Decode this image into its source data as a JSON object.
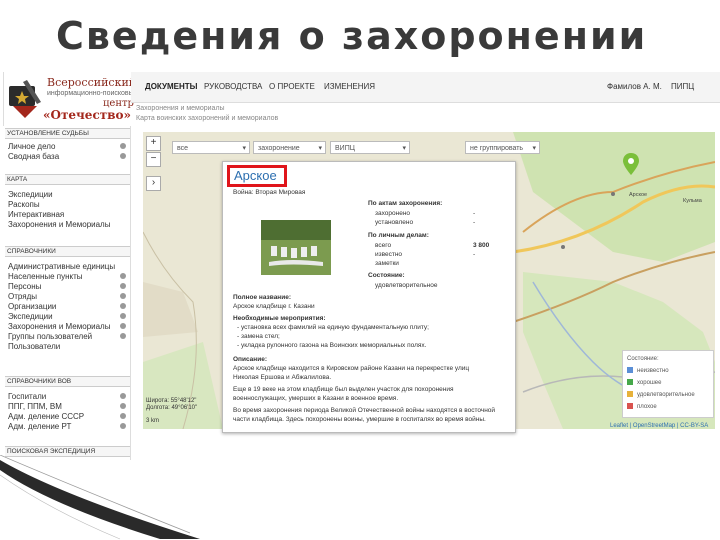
{
  "slide_title": "Сведения о захоронении",
  "logo": {
    "line1": "Всероссийский",
    "line2": "информационно-поисковый",
    "line3": "центр",
    "line4": "«Отечество»"
  },
  "topnav": {
    "items": [
      "ДОКУМЕНТЫ",
      "РУКОВОДСТВА",
      "О ПРОЕКТЕ",
      "ИЗМЕНЕНИЯ"
    ],
    "user": "Фамилов А. М.",
    "org": "ПИПЦ"
  },
  "breadcrumb": {
    "line1": "Захоронения и мемориалы",
    "line2": "Карта воинских захоронений и мемориалов"
  },
  "sidebar": {
    "section1": "УСТАНОВЛЕНИЕ СУДЬБЫ",
    "section1_items": [
      "Личное дело",
      "Сводная база"
    ],
    "section2": "КАРТА",
    "section2_items": [
      "Экспедиции",
      "Раскопы",
      "Интерактивная",
      "Захоронения и Мемориалы"
    ],
    "section3": "СПРАВОЧНИКИ",
    "section3_items": [
      "Административные единицы",
      "Населенные пункты",
      "Персоны",
      "Отряды",
      "Организации",
      "Экспедиции",
      "Захоронения и Мемориалы",
      "Группы пользователей",
      "Пользователи"
    ],
    "section4": "СПРАВОЧНИКИ ВОВ",
    "section4_items": [
      "Госпитали",
      "ППГ, ППМ, ВМ",
      "Адм. деление СССР",
      "Адм. деление РТ"
    ],
    "section5": "ПОИСКОВАЯ ЭКСПЕДИЦИЯ"
  },
  "map": {
    "zoom_in": "+",
    "zoom_out": "−",
    "toggle": "›",
    "filters": [
      "все",
      "захоронение",
      "ВИПЦ",
      "не группировать"
    ],
    "scale_label": "3 km",
    "coord_line1": "Широта: 55°48'12\"",
    "coord_line2": "Долгота: 49°06'10\"",
    "attribution": "Leaflet | OpenStreetMap | CC-BY-SA",
    "place_label1": "Арское",
    "place_label2": "Кульма"
  },
  "popup": {
    "title": "Арское",
    "war": "Война: Вторая Мировая",
    "acts_header": "По актам захоронения:",
    "buried_label": "захоронено",
    "buried_value": "-",
    "identified_label": "установлено",
    "identified_value": "-",
    "personal_header": "По личным делам:",
    "total_label": "всего",
    "total_value": "3 800",
    "known_label": "известно",
    "known_value": "-",
    "notes_label": "заметки",
    "state_header": "Состояние:",
    "state_value": "удовлетворительное",
    "full_name_header": "Полное название:",
    "full_name_value": "Арское кладбище г. Казани",
    "measures_header": "Необходимые мероприятия:",
    "measures": [
      "- установка всех фамилий на единую фундаментальную плиту;",
      "- замена стел;",
      "- укладка рулонного газона на Воинских мемориальных полях."
    ],
    "desc_header": "Описание:",
    "desc_lines": [
      "Арское кладбище находится в Кировском районе Казани на перекрестке улиц",
      "Николая Ершова и Абжалилова.",
      "Еще в 19 веке на этом кладбище был выделен участок для похоронения",
      "военнослужащих, умерших в Казани в военное время.",
      "Во время захоронения периода Великой Отечественной войны находятся в восточной",
      "части кладбища. Здесь похоронены воины, умершие в госпиталях во время войны."
    ]
  },
  "legend": {
    "title": "Состояние:",
    "items": [
      {
        "label": "неизвестно",
        "color": "#5b8fd6"
      },
      {
        "label": "хорошее",
        "color": "#46a84a"
      },
      {
        "label": "удовлетворительное",
        "color": "#e7b23a"
      },
      {
        "label": "плохое",
        "color": "#d9534f"
      }
    ]
  },
  "colors": {
    "accent_red": "#e0151b",
    "link_blue": "#2d6fb0",
    "pin_green": "#7bbf3a"
  }
}
